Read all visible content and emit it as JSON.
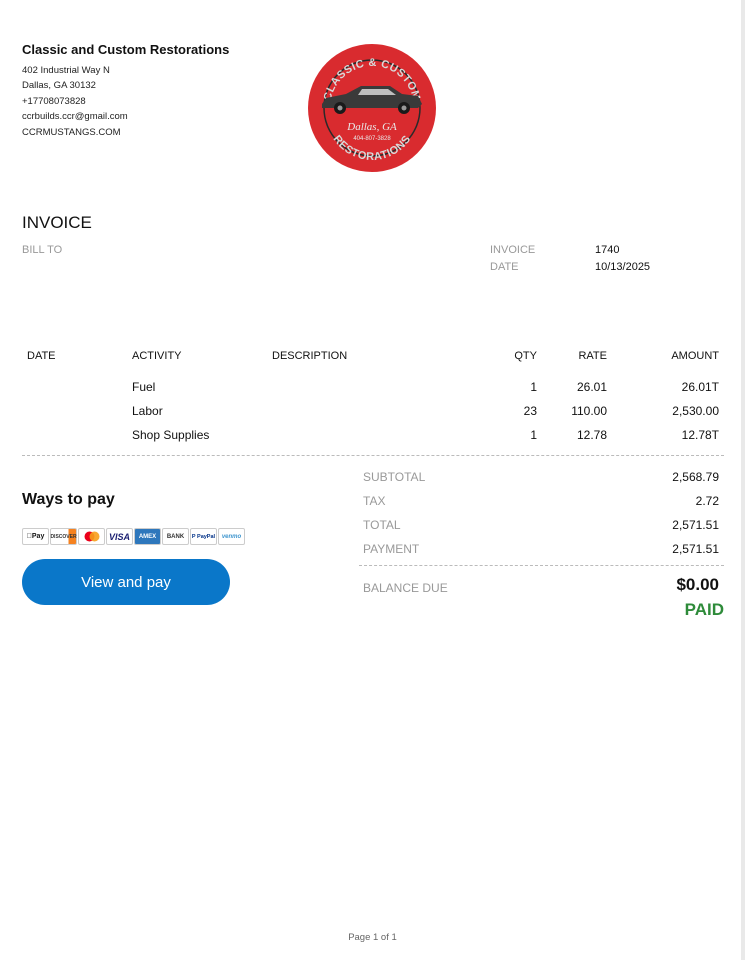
{
  "company": {
    "name": "Classic and Custom Restorations",
    "address1": "402 Industrial Way N",
    "address2": "Dallas, GA  30132",
    "phone": "+17708073828",
    "email": "ccrbuilds.ccr@gmail.com",
    "website": "CCRMUSTANGS.COM"
  },
  "logo": {
    "top_text": "CLASSIC & CUSTOM",
    "city": "Dallas, GA",
    "phone": "404-807-3828",
    "bottom_text": "RESTORATIONS",
    "color": "#d92b2f"
  },
  "invoice": {
    "title": "INVOICE",
    "bill_to_label": "BILL TO",
    "invoice_label": "INVOICE",
    "invoice_number": "1740",
    "date_label": "DATE",
    "date": "10/13/2025"
  },
  "table": {
    "headers": {
      "date": "DATE",
      "activity": "ACTIVITY",
      "description": "DESCRIPTION",
      "qty": "QTY",
      "rate": "RATE",
      "amount": "AMOUNT"
    },
    "rows": [
      {
        "activity": "Fuel",
        "qty": "1",
        "rate": "26.01",
        "amount": "26.01T"
      },
      {
        "activity": "Labor",
        "qty": "23",
        "rate": "110.00",
        "amount": "2,530.00"
      },
      {
        "activity": "Shop Supplies",
        "qty": "1",
        "rate": "12.78",
        "amount": "12.78T"
      }
    ]
  },
  "payment": {
    "heading": "Ways to pay",
    "methods": [
      "Apple Pay",
      "Discover",
      "Mastercard",
      "Visa",
      "American Express",
      "Bank",
      "PayPal",
      "Venmo"
    ],
    "button_label": "View and pay",
    "button_color": "#0a77c9"
  },
  "summary": {
    "subtotal_label": "SUBTOTAL",
    "subtotal": "2,568.79",
    "tax_label": "TAX",
    "tax": "2.72",
    "total_label": "TOTAL",
    "total": "2,571.51",
    "payment_label": "PAYMENT",
    "payment": "2,571.51",
    "balance_label": "BALANCE DUE",
    "balance": "$0.00",
    "status": "PAID",
    "status_color": "#2e8b3a"
  },
  "footer": {
    "page": "Page 1 of 1"
  }
}
